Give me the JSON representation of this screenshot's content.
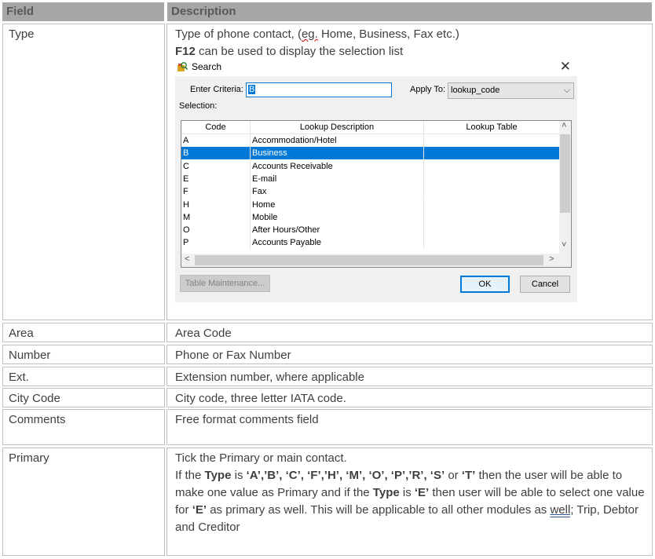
{
  "table": {
    "header": {
      "field": "Field",
      "description": "Description"
    },
    "rows": [
      {
        "field": "Type",
        "desc_line1_pre": "Type of phone contact, (",
        "desc_line1_eg": "eg.",
        "desc_line1_post": " Home, Business, Fax etc.)",
        "desc_line2_bold": "F12",
        "desc_line2_rest": " can be used to display the selection list"
      },
      {
        "field": "Area",
        "description": "Area Code"
      },
      {
        "field": "Number",
        "description": "Phone or Fax Number"
      },
      {
        "field": "Ext.",
        "description": "Extension number, where applicable"
      },
      {
        "field": "City Code",
        "description": "City code, three letter IATA code."
      },
      {
        "field": "Comments",
        "description": "Free format comments field"
      },
      {
        "field": "Primary",
        "p1": "Tick the Primary or main contact.",
        "p2_a": "If the ",
        "p2_b": "Type",
        "p2_c": " is ",
        "p2_d": "‘A’,’B’, ‘C’, ‘F’,’H’, ‘M’, ‘O’, ‘P’,’R’, ‘S’",
        "p2_e": " or ",
        "p2_f": "‘T’",
        "p2_g": " then the user will be able to make one value as Primary and if the ",
        "p2_h": "Type",
        "p2_i": " is ",
        "p2_j": "‘E’",
        "p2_k": " then user will be able to select one value for ",
        "p2_l": "‘E’",
        "p2_m": " as primary as well. This will be applicable to all other modules as ",
        "p2_n": "well;",
        "p2_o": " Trip, Debtor and Creditor"
      }
    ]
  },
  "dialog": {
    "title": "Search",
    "close_glyph": "✕",
    "criteria_label": "Enter Criteria:",
    "criteria_value": "B",
    "apply_label": "Apply To:",
    "apply_value": "lookup_code",
    "selection_label": "Selection:",
    "columns": [
      "Code",
      "Lookup Description",
      "Lookup Table"
    ],
    "rows": [
      {
        "code": "A",
        "desc": "Accommodation/Hotel",
        "table": ""
      },
      {
        "code": "B",
        "desc": "Business",
        "table": ""
      },
      {
        "code": "C",
        "desc": "Accounts Receivable",
        "table": ""
      },
      {
        "code": "E",
        "desc": "E-mail",
        "table": ""
      },
      {
        "code": "F",
        "desc": "Fax",
        "table": ""
      },
      {
        "code": "H",
        "desc": "Home",
        "table": ""
      },
      {
        "code": "M",
        "desc": "Mobile",
        "table": ""
      },
      {
        "code": "O",
        "desc": "After Hours/Other",
        "table": ""
      },
      {
        "code": "P",
        "desc": "Accounts Payable",
        "table": ""
      }
    ],
    "selected_code": "B",
    "table_maintenance_label": "Table Maintenance...",
    "ok_label": "OK",
    "cancel_label": "Cancel"
  }
}
